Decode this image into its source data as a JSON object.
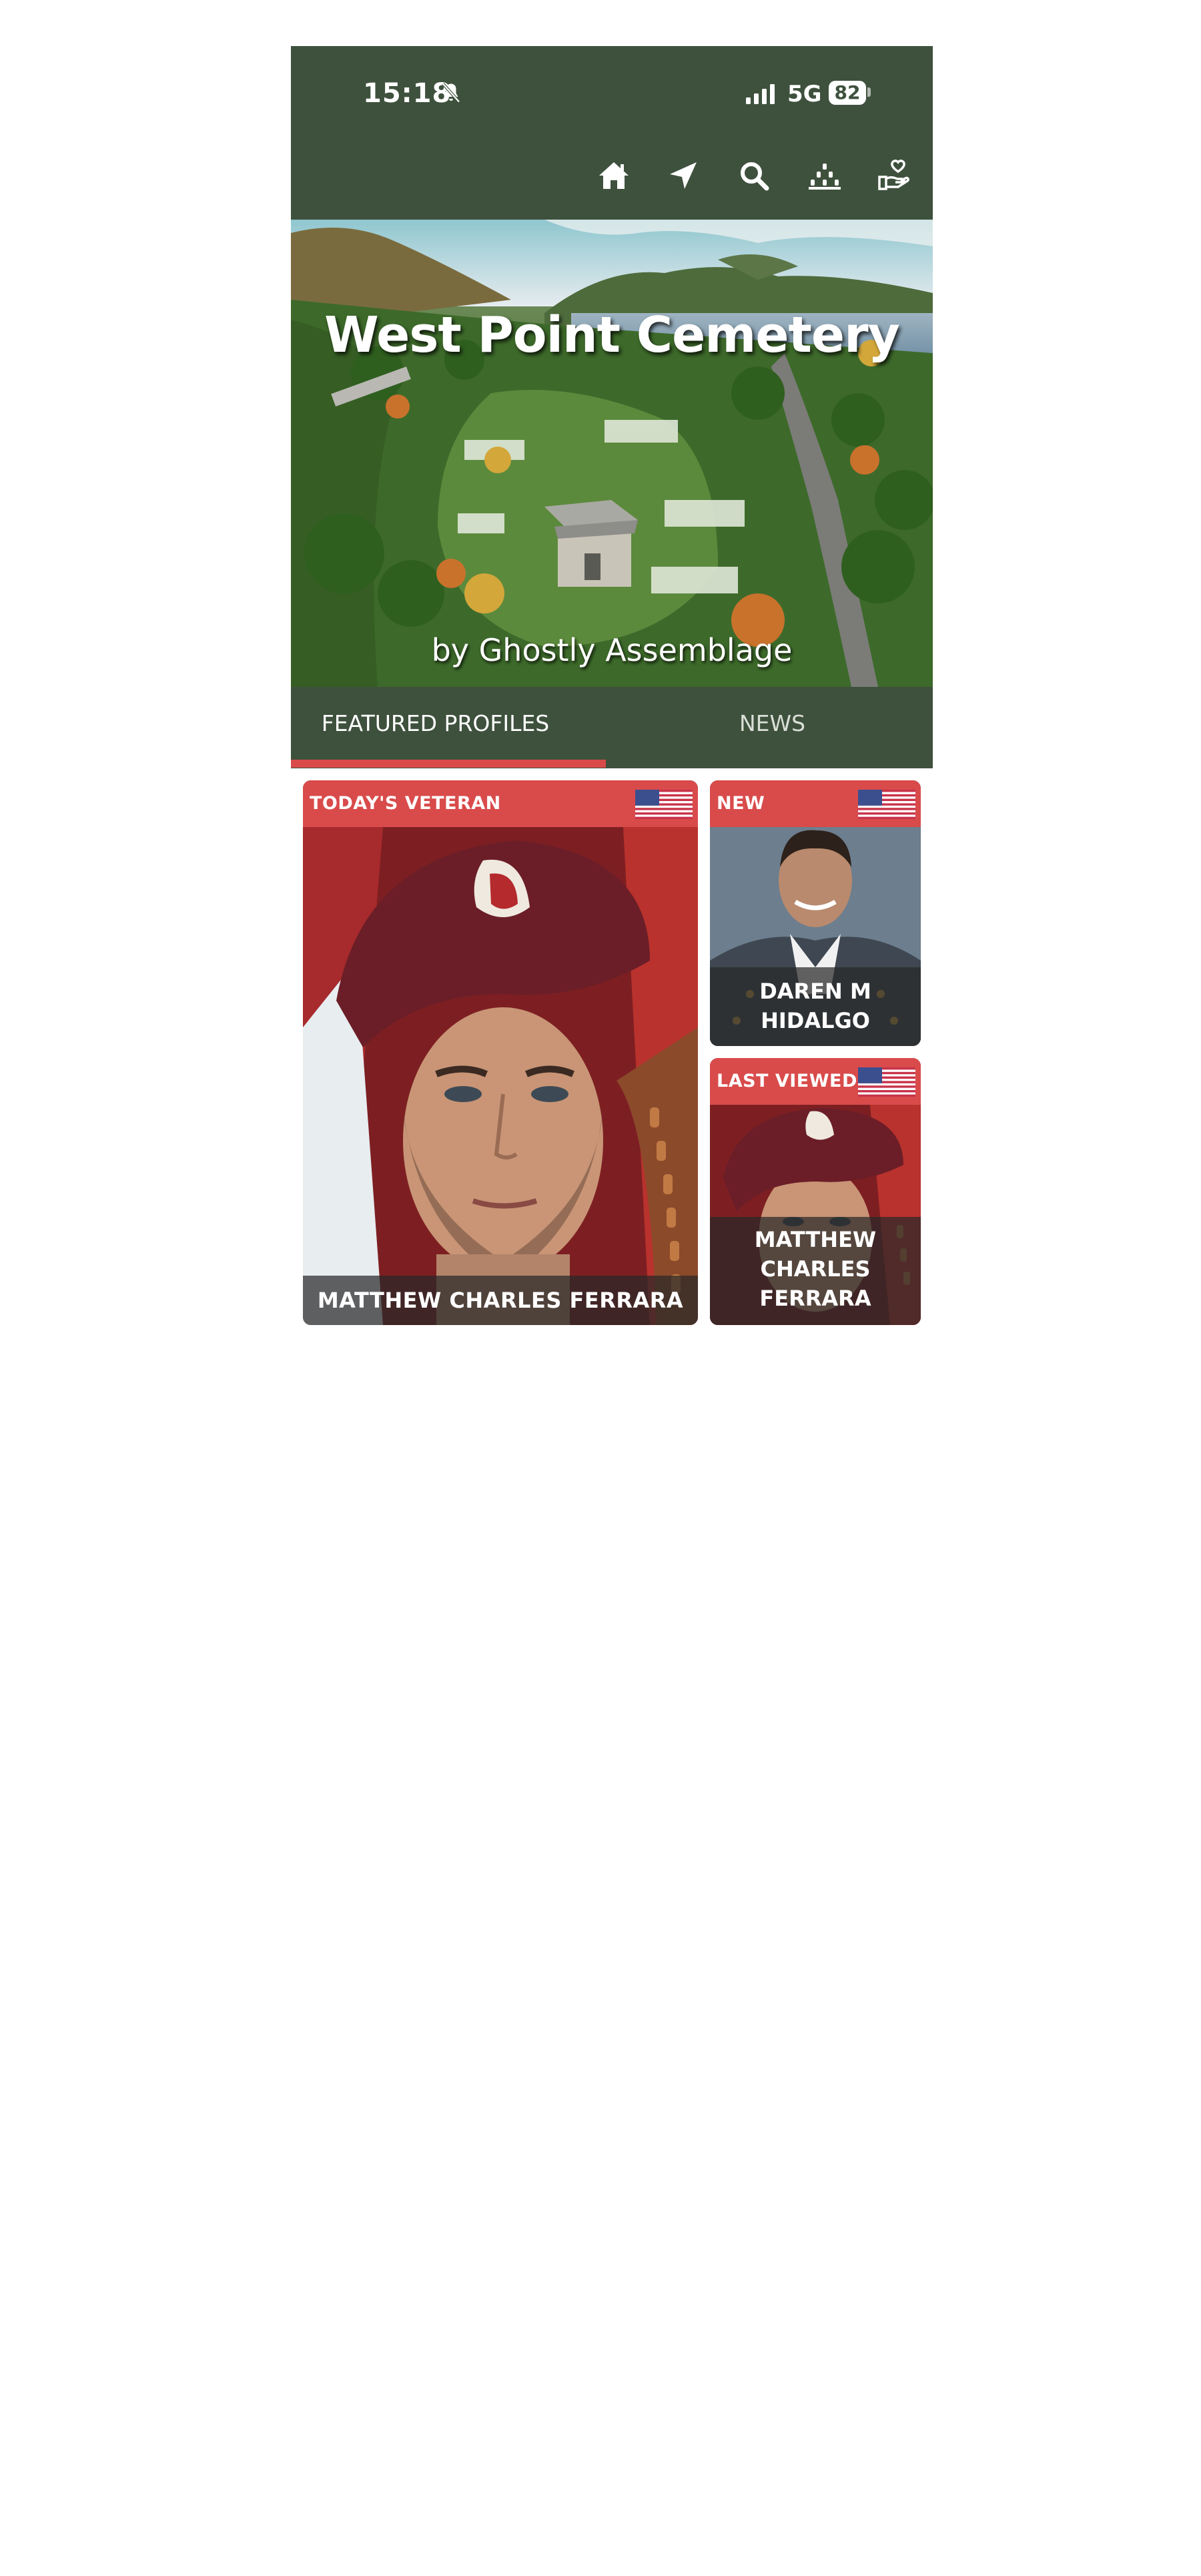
{
  "status_bar": {
    "time": "15:18",
    "network": "5G",
    "battery": "82",
    "icons": [
      "bell-off-icon",
      "signal-icon",
      "battery-icon"
    ]
  },
  "nav": {
    "icons": [
      "home-icon",
      "location-arrow-icon",
      "search-icon",
      "grave-markers-icon",
      "donate-hand-heart-icon"
    ]
  },
  "hero": {
    "title": "West Point Cemetery",
    "subtitle": "by Ghostly Assemblage"
  },
  "tabs": [
    {
      "label": "FEATURED PROFILES",
      "active": true
    },
    {
      "label": "NEWS",
      "active": false
    }
  ],
  "cards": {
    "todays_veteran": {
      "label": "TODAY'S VETERAN",
      "name": "MATTHEW CHARLES FERRARA",
      "icon": "us-flag-icon"
    },
    "new": {
      "label": "NEW",
      "name_line1": "DAREN M",
      "name_line2": "HIDALGO",
      "icon": "us-flag-icon"
    },
    "last_viewed": {
      "label": "LAST VIEWED",
      "name_line1": "MATTHEW",
      "name_line2": "CHARLES",
      "name_line3": "FERRARA",
      "icon": "us-flag-icon"
    }
  },
  "colors": {
    "header_green": "#3e513d",
    "accent_red": "#d94b4b",
    "text_white": "#ffffff"
  }
}
